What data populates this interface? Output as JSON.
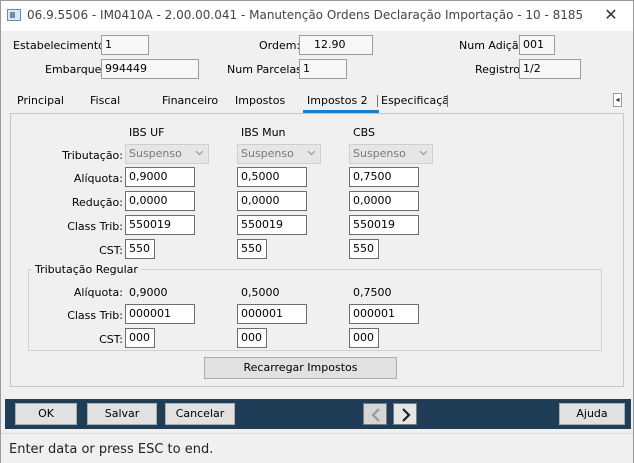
{
  "window": {
    "title": "06.9.5506 - IM0410A - 2.00.00.041 - Manutenção Ordens Declaração Importação - 10 - 8185",
    "close_glyph": "✕"
  },
  "header": {
    "estabelecimento_label": "Estabelecimento:",
    "estabelecimento_value": "1",
    "ordem_label": "Ordem:",
    "ordem_value": "12.90",
    "num_adicao_label": "Num Adição:",
    "num_adicao_value": "001",
    "embarque_label": "Embarque:",
    "embarque_value": "994449",
    "num_parcelas_label": "Num Parcelas:",
    "num_parcelas_value": "1",
    "registro_label": "Registro:",
    "registro_value": "1/2"
  },
  "tabs": [
    {
      "label": "Principal"
    },
    {
      "label": "Fiscal"
    },
    {
      "label": "Financeiro"
    },
    {
      "label": "Impostos"
    },
    {
      "label": "Impostos 2",
      "active": true
    },
    {
      "label": "Especificação"
    }
  ],
  "tab_scroll": {
    "left": "◂",
    "right": "▸"
  },
  "tax": {
    "columns": [
      "IBS UF",
      "IBS Mun",
      "CBS"
    ],
    "row_labels": {
      "tributacao": "Tributação:",
      "aliquota": "Alíquota:",
      "reducao": "Redução:",
      "class_trib": "Class Trib:",
      "cst": "CST:"
    },
    "tributacao": [
      "Suspenso",
      "Suspenso",
      "Suspenso"
    ],
    "aliquota": [
      "0,9000",
      "0,5000",
      "0,7500"
    ],
    "reducao": [
      "0,0000",
      "0,0000",
      "0,0000"
    ],
    "class_trib": [
      "550019",
      "550019",
      "550019"
    ],
    "cst": [
      "550",
      "550",
      "550"
    ]
  },
  "regular": {
    "title": "Tributação Regular",
    "row_labels": {
      "aliquota": "Alíquota:",
      "class_trib": "Class Trib:",
      "cst": "CST:"
    },
    "aliquota": [
      "0,9000",
      "0,5000",
      "0,7500"
    ],
    "class_trib": [
      "000001",
      "000001",
      "000001"
    ],
    "cst": [
      "000",
      "000",
      "000"
    ]
  },
  "buttons": {
    "recarregar": "Recarregar Impostos",
    "ok": "OK",
    "salvar": "Salvar",
    "cancelar": "Cancelar",
    "ajuda": "Ajuda"
  },
  "status": {
    "text": "Enter data or press ESC to end."
  },
  "colors": {
    "toolbar": "#1f3d57",
    "tab_accent": "#1a7fd0"
  }
}
